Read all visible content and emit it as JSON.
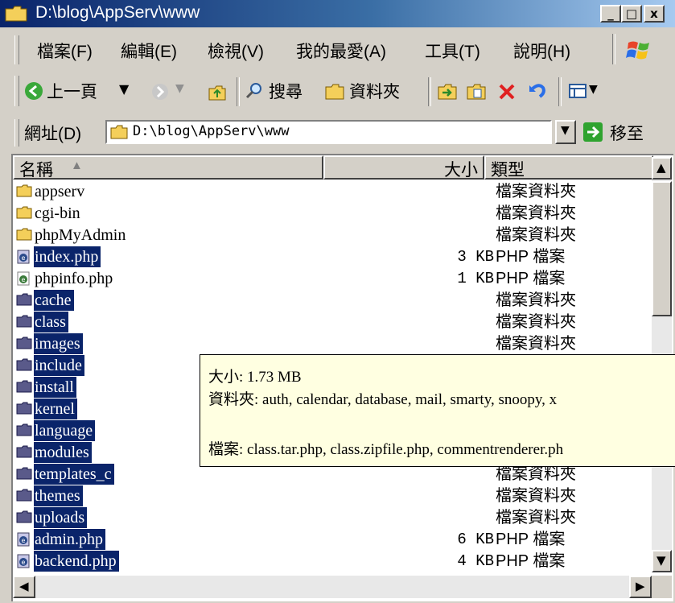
{
  "window": {
    "title": "D:\\blog\\AppServ\\www"
  },
  "titlebar_buttons": [
    "_",
    "□",
    "x"
  ],
  "menu": [
    "檔案(F)",
    "編輯(E)",
    "檢視(V)",
    "我的最愛(A)",
    "工具(T)",
    "說明(H)"
  ],
  "toolbar": {
    "back_label": "上一頁",
    "search_label": "搜尋",
    "folders_label": "資料夾"
  },
  "address": {
    "label": "網址(D)",
    "value": "D:\\blog\\AppServ\\www",
    "go_label": "移至"
  },
  "columns": {
    "name": "名稱",
    "size": "大小",
    "type": "類型"
  },
  "files": [
    {
      "name": "appserv",
      "size": "",
      "type": "檔案資料夾",
      "kind": "folder",
      "selected": false
    },
    {
      "name": "cgi-bin",
      "size": "",
      "type": "檔案資料夾",
      "kind": "folder",
      "selected": false
    },
    {
      "name": "phpMyAdmin",
      "size": "",
      "type": "檔案資料夾",
      "kind": "folder",
      "selected": false
    },
    {
      "name": "index.php",
      "size": "3 KB",
      "type": "PHP 檔案",
      "kind": "php",
      "selected": true
    },
    {
      "name": "phpinfo.php",
      "size": "1 KB",
      "type": "PHP 檔案",
      "kind": "php",
      "selected": false
    },
    {
      "name": "cache",
      "size": "",
      "type": "檔案資料夾",
      "kind": "folder",
      "selected": true
    },
    {
      "name": "class",
      "size": "",
      "type": "檔案資料夾",
      "kind": "folder",
      "selected": true
    },
    {
      "name": "images",
      "size": "",
      "type": "檔案資料夾",
      "kind": "folder",
      "selected": true
    },
    {
      "name": "include",
      "size": "",
      "type": "",
      "kind": "folder",
      "selected": true
    },
    {
      "name": "install",
      "size": "",
      "type": "",
      "kind": "folder",
      "selected": true
    },
    {
      "name": "kernel",
      "size": "",
      "type": "",
      "kind": "folder",
      "selected": true
    },
    {
      "name": "language",
      "size": "",
      "type": "",
      "kind": "folder",
      "selected": true
    },
    {
      "name": "modules",
      "size": "",
      "type": "",
      "kind": "folder",
      "selected": true
    },
    {
      "name": "templates_c",
      "size": "",
      "type": "檔案資料夾",
      "kind": "folder",
      "selected": true
    },
    {
      "name": "themes",
      "size": "",
      "type": "檔案資料夾",
      "kind": "folder",
      "selected": true
    },
    {
      "name": "uploads",
      "size": "",
      "type": "檔案資料夾",
      "kind": "folder",
      "selected": true
    },
    {
      "name": "admin.php",
      "size": "6 KB",
      "type": "PHP 檔案",
      "kind": "php",
      "selected": true
    },
    {
      "name": "backend.php",
      "size": "4 KB",
      "type": "PHP 檔案",
      "kind": "php",
      "selected": true
    }
  ],
  "tooltip": {
    "size_line": "大小: 1.73 MB",
    "folders_line": "資料夾: auth, calendar, database, mail, smarty, snoopy, x",
    "files_line": "檔案: class.tar.php, class.zipfile.php, commentrenderer.ph"
  },
  "colors": {
    "selection": "#0a246a",
    "tooltip_bg": "#ffffe1",
    "folder": "#f4cf5a"
  }
}
